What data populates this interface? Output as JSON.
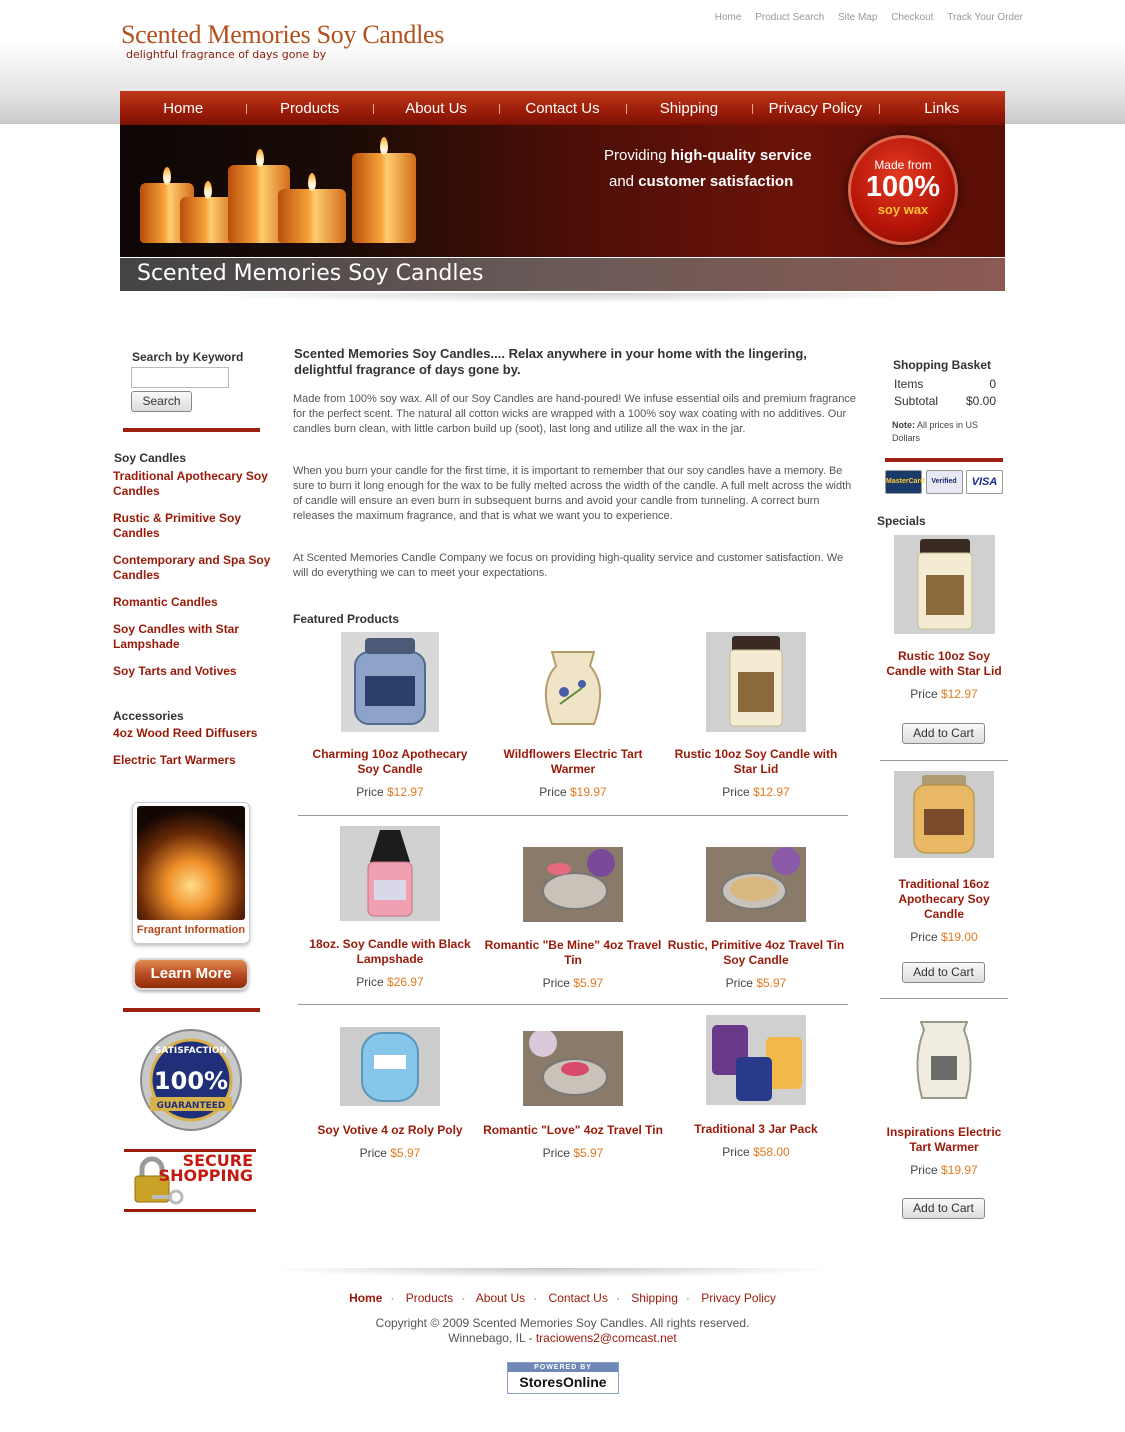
{
  "header": {
    "logo_title": "Scented Memories Soy Candles",
    "logo_tagline": "delightful fragrance of days gone by",
    "top_links": [
      "Home",
      "Product Search",
      "Site Map",
      "Checkout",
      "Track Your Order"
    ]
  },
  "nav": [
    "Home",
    "Products",
    "About Us",
    "Contact Us",
    "Shipping",
    "Privacy Policy",
    "Links"
  ],
  "banner": {
    "line1_plain": "Providing ",
    "line1_bold": "high-quality service",
    "line2_plain": "and ",
    "line2_bold": "customer satisfaction",
    "badge_top": "Made from",
    "badge_number": "100%",
    "badge_bottom": "soy wax",
    "title_bar": "Scented Memories Soy Candles"
  },
  "sidebar": {
    "search_label": "Search by Keyword",
    "search_placeholder": "",
    "search_button": "Search",
    "soy_heading": "Soy Candles",
    "soy_links": [
      "Traditional Apothecary Soy Candles",
      "Rustic & Primitive Soy Candles",
      "Contemporary and Spa Soy Candles",
      "Romantic Candles",
      "Soy Candles with Star Lampshade",
      "Soy Tarts and Votives"
    ],
    "acc_heading": "Accessories",
    "acc_links": [
      "4oz Wood Reed Diffusers",
      "Electric Tart Warmers"
    ],
    "fragrant_label": "Fragrant Information",
    "learn_more": "Learn More",
    "seal_top": "SATISFACTION",
    "seal_num": "100%",
    "seal_bottom": "GUARANTEED",
    "secure_line1": "SECURE",
    "secure_line2": "SHOPPING"
  },
  "main": {
    "intro_title": "Scented Memories Soy Candles.... Relax anywhere in your home with the lingering, delightful fragrance of days gone by.",
    "paragraphs": [
      "Made from 100% soy wax. All of our Soy Candles are hand-poured! We infuse essential oils and premium fragrance for the perfect scent. The natural all cotton wicks are wrapped with a 100% soy wax coating with no additives. Our candles burn clean, with little carbon build up (soot), last long and utilize all the wax in the jar.",
      "When you burn your candle for the first time, it is important to remember that our soy candles have a memory. Be sure to burn it long enough for the wax to be fully melted across the width of the candle. A full melt across the width of candle will ensure an even burn in subsequent burns and avoid your candle from tunneling. A correct burn releases the maximum fragrance, and that is what we want you to experience.",
      "At Scented Memories Candle Company we focus on providing high-quality service and customer satisfaction. We will do everything we can to meet your expectations."
    ],
    "featured_label": "Featured Products",
    "price_label": "Price",
    "products": [
      {
        "name": "Charming 10oz Apothecary Soy Candle",
        "price": "$12.97"
      },
      {
        "name": "Wildflowers Electric Tart Warmer",
        "price": "$19.97"
      },
      {
        "name": "Rustic 10oz Soy Candle with Star Lid",
        "price": "$12.97"
      },
      {
        "name": "18oz. Soy Candle with Black Lampshade",
        "price": "$26.97"
      },
      {
        "name": "Romantic \"Be Mine\" 4oz Travel Tin",
        "price": "$5.97"
      },
      {
        "name": "Rustic, Primitive 4oz Travel Tin Soy Candle",
        "price": "$5.97"
      },
      {
        "name": "Soy Votive 4 oz Roly Poly",
        "price": "$5.97"
      },
      {
        "name": "Romantic \"Love\" 4oz Travel Tin",
        "price": "$5.97"
      },
      {
        "name": "Traditional 3 Jar Pack",
        "price": "$58.00"
      }
    ]
  },
  "basket": {
    "title": "Shopping Basket",
    "items_label": "Items",
    "items_value": "0",
    "subtotal_label": "Subtotal",
    "subtotal_value": "$0.00",
    "note_bold": "Note:",
    "note_text": " All prices in US Dollars",
    "cards": [
      "MasterCard",
      "Verified",
      "VISA"
    ]
  },
  "specials": {
    "label": "Specials",
    "price_label": "Price",
    "cart_label": "Add to Cart",
    "items": [
      {
        "name": "Rustic 10oz Soy Candle with Star Lid",
        "price": "$12.97"
      },
      {
        "name": "Traditional 16oz Apothecary Soy Candle",
        "price": "$19.00"
      },
      {
        "name": "Inspirations Electric Tart Warmer",
        "price": "$19.97"
      }
    ]
  },
  "footer": {
    "links": [
      "Home",
      "Products",
      "About Us",
      "Contact Us",
      "Shipping",
      "Privacy Policy"
    ],
    "copyright": "Copyright © 2009 Scented Memories Soy Candles. All rights reserved.",
    "location": "Winnebago, IL - ",
    "email": "traciowens2@comcast.net",
    "powered_top": "POWERED BY",
    "powered_main": "StoresOnline"
  },
  "colors": {
    "brand_red": "#9a1a0a",
    "price_orange": "#e07a20",
    "nav_red": "#b02a12"
  }
}
